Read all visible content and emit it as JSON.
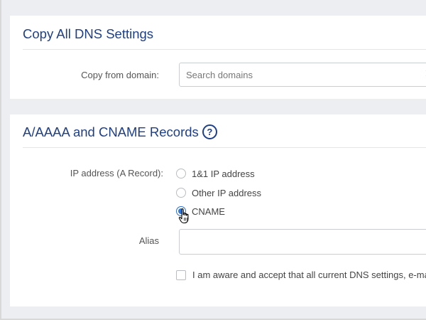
{
  "copy_dns": {
    "title": "Copy All DNS Settings",
    "copy_from_label": "Copy from domain:",
    "search_placeholder": "Search domains",
    "search_value": ""
  },
  "records": {
    "title": "A/AAAA and CNAME Records",
    "help_glyph": "?",
    "ip_label": "IP address (A Record):",
    "options": [
      {
        "label": "1&1 IP address",
        "selected": false
      },
      {
        "label": "Other IP address",
        "selected": false
      },
      {
        "label": "CNAME",
        "selected": true
      }
    ],
    "alias_label": "Alias",
    "alias_value": "",
    "accept_label": "I am aware and accept that all current DNS settings, e-ma",
    "accept_checked": false
  },
  "icons": {
    "clear": "clear-icon",
    "help": "help-icon",
    "cursor": "hand-pointer-cursor-icon"
  },
  "colors": {
    "title": "#1f3f85",
    "radio_selected": "#2f7ae0",
    "background": "#eceef1"
  }
}
